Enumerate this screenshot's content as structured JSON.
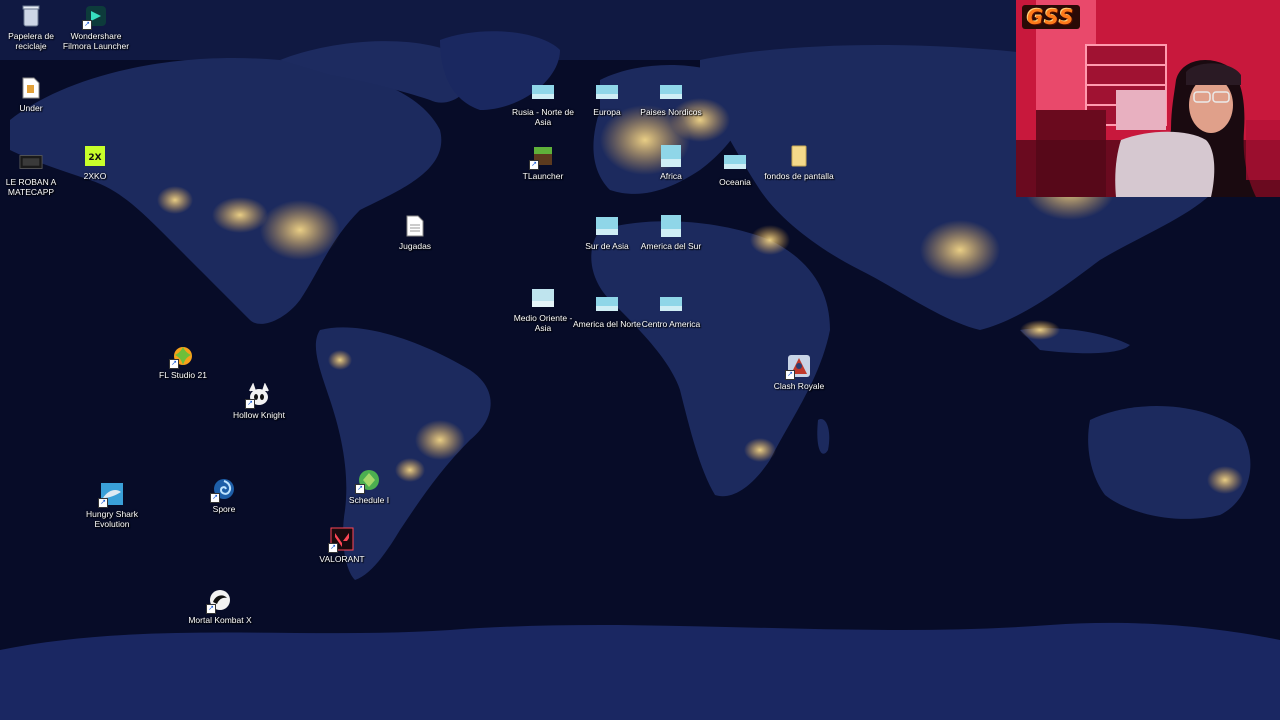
{
  "desktop": {
    "icons": [
      {
        "label": "Papelera de reciclaje",
        "icon": "recycle-bin-icon"
      },
      {
        "label": "Wondershare Filmora Launcher",
        "icon": "filmora-icon"
      },
      {
        "label": "Under",
        "icon": "document-icon"
      },
      {
        "label": "LE ROBAN A MATECAPP",
        "icon": "video-file-icon"
      },
      {
        "label": "2XKO",
        "icon": "game-2xko-icon"
      },
      {
        "label": "Rusia - Norte de Asia",
        "icon": "image-file-icon"
      },
      {
        "label": "Europa",
        "icon": "image-file-icon"
      },
      {
        "label": "Paises Nordicos",
        "icon": "image-file-icon"
      },
      {
        "label": "TLauncher",
        "icon": "minecraft-icon"
      },
      {
        "label": "Africa",
        "icon": "image-file-icon"
      },
      {
        "label": "Oceania",
        "icon": "image-file-icon"
      },
      {
        "label": "fondos de pantalla",
        "icon": "folder-icon"
      },
      {
        "label": "Jugadas",
        "icon": "text-file-icon"
      },
      {
        "label": "Sur de Asia",
        "icon": "image-file-icon"
      },
      {
        "label": "America del Sur",
        "icon": "image-file-icon"
      },
      {
        "label": "Medio Oriente - Asia",
        "icon": "image-file-icon"
      },
      {
        "label": "America del Norte",
        "icon": "image-file-icon"
      },
      {
        "label": "Centro America",
        "icon": "image-file-icon"
      },
      {
        "label": "Clash Royale",
        "icon": "clash-royale-icon"
      },
      {
        "label": "FL Studio 21",
        "icon": "fl-studio-icon"
      },
      {
        "label": "Hollow Knight",
        "icon": "hollow-knight-icon"
      },
      {
        "label": "Schedule I",
        "icon": "schedule-one-icon"
      },
      {
        "label": "Hungry Shark Evolution",
        "icon": "hungry-shark-icon"
      },
      {
        "label": "Spore",
        "icon": "spore-icon"
      },
      {
        "label": "VALORANT",
        "icon": "valorant-icon"
      },
      {
        "label": "Mortal Kombat X",
        "icon": "mortal-kombat-icon"
      }
    ]
  },
  "webcam": {
    "logo_text": "GSS"
  },
  "colors": {
    "wallpaper_ocean": "#0a1030",
    "wallpaper_land": "#1a2658",
    "city_lights": "#ffd27a",
    "webcam_accent": "#ff3b5c"
  }
}
